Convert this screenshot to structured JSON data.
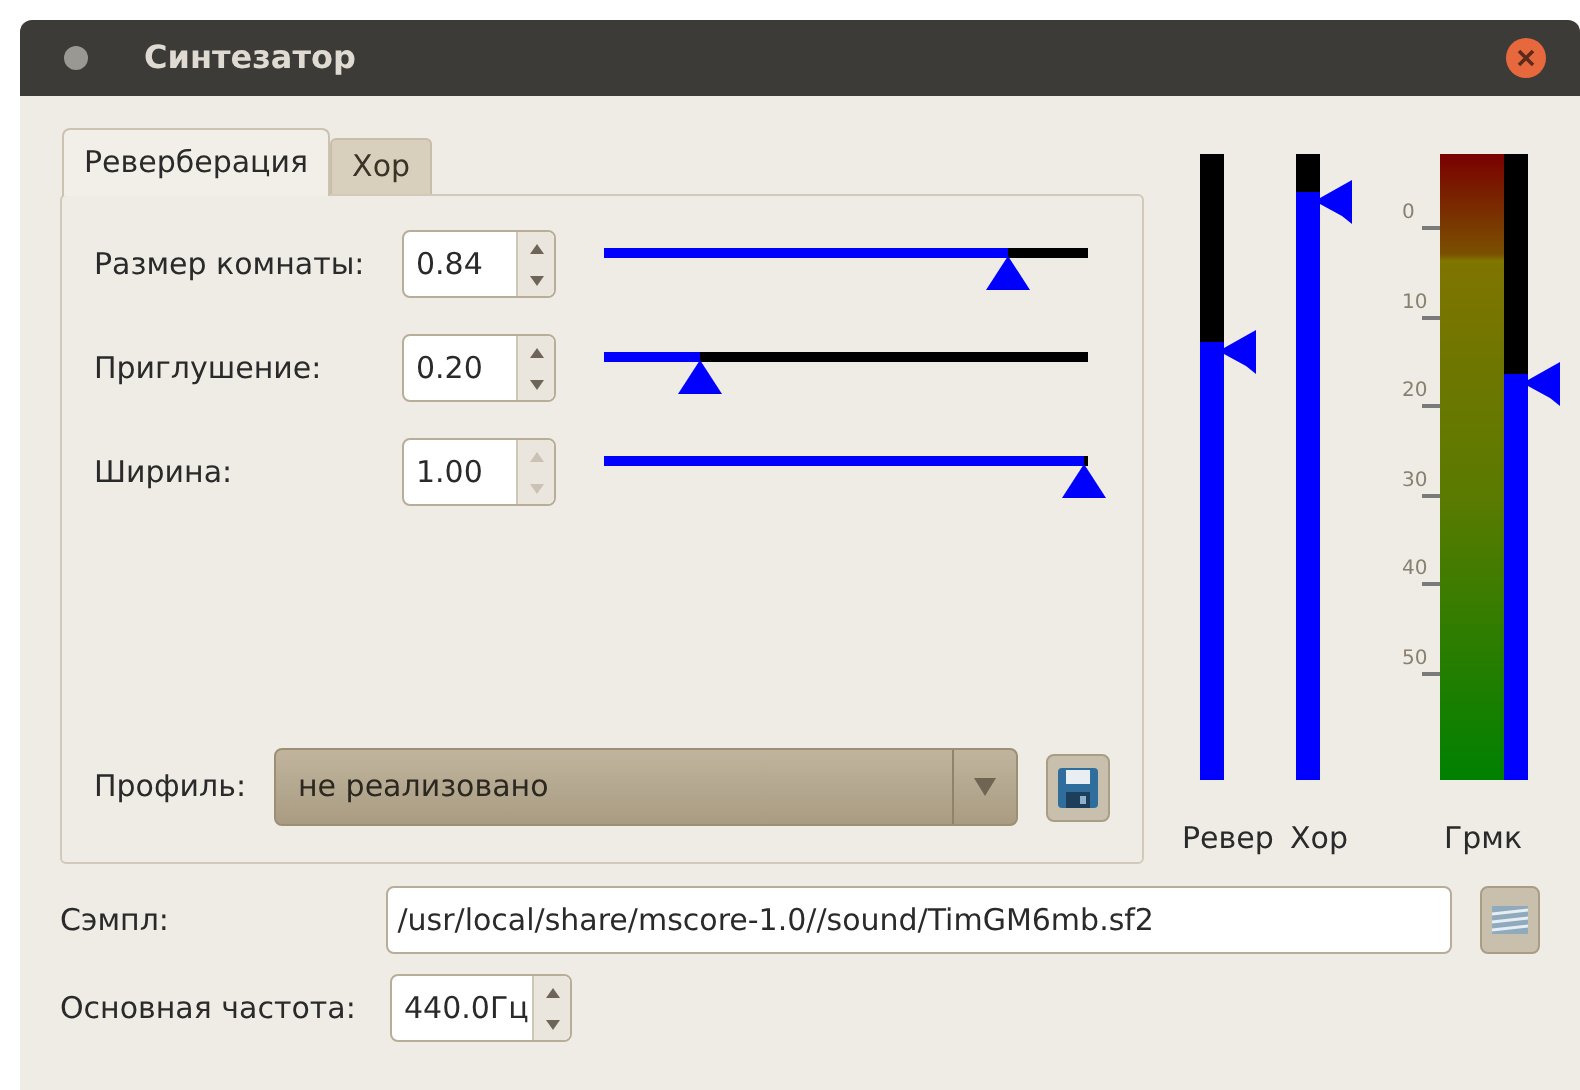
{
  "window": {
    "title": "Синтезатор"
  },
  "tabs": [
    {
      "label": "Реверберация",
      "selected": true
    },
    {
      "label": "Хор",
      "selected": false
    }
  ],
  "parameters": [
    {
      "label": "Размер комнаты:",
      "value": "0.84",
      "level": 0.84,
      "up_disabled": false
    },
    {
      "label": "Приглушение:",
      "value": "0.20",
      "level": 0.2,
      "up_disabled": false
    },
    {
      "label": "Ширина:",
      "value": "1.00",
      "level": 1.0,
      "up_disabled": true
    }
  ],
  "profile": {
    "label": "Профиль:",
    "value": "не реализовано"
  },
  "faders": [
    {
      "kind": "fader",
      "label": "Ревер",
      "level": 0.7
    },
    {
      "kind": "fader",
      "label": "Хор",
      "level": 0.94
    },
    {
      "kind": "meter",
      "label": "Грмк",
      "level": 0.65,
      "scale": [
        "0",
        "10",
        "20",
        "30",
        "40",
        "50"
      ]
    }
  ],
  "sample": {
    "label": "Сэмпл:",
    "value": "/usr/local/share/mscore-1.0//sound/TimGM6mb.sf2"
  },
  "base_frequency": {
    "label": "Основная частота:",
    "value": "440.0Гц"
  }
}
